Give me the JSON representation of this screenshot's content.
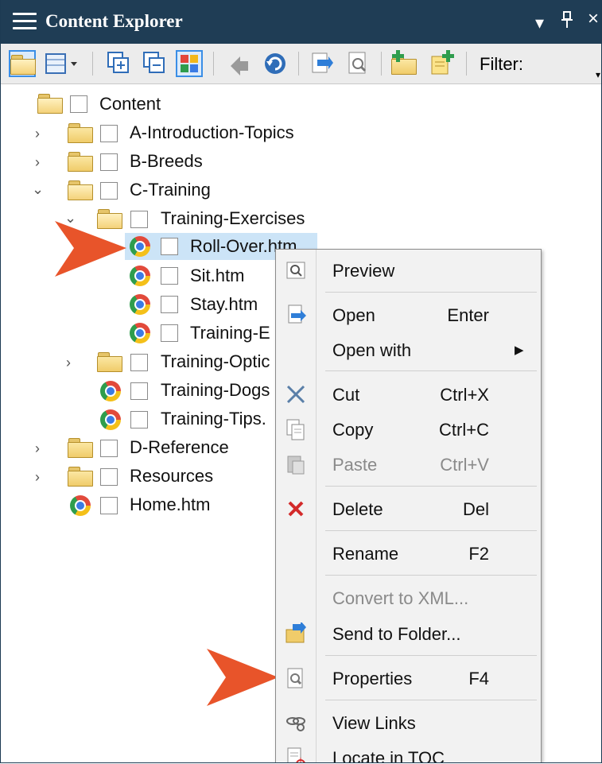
{
  "titlebar": {
    "title": "Content Explorer",
    "dropdown_glyph": "▾",
    "pin_glyph": "ᵽ",
    "close_glyph": "×"
  },
  "toolbar": {
    "filter_label": "Filter:",
    "icons": [
      "open-folder-icon",
      "view-dropdown-icon",
      "expand-all-icon",
      "collapse-all-icon",
      "grid-icon",
      "forward-icon",
      "refresh-icon",
      "bind-icon",
      "properties-icon",
      "new-folder-icon",
      "add-file-icon"
    ]
  },
  "tree": {
    "root": "Content",
    "items": [
      {
        "label": "A-Introduction-Topics",
        "type": "folder",
        "expander": ">"
      },
      {
        "label": "B-Breeds",
        "type": "folder",
        "expander": ">"
      },
      {
        "label": "C-Training",
        "type": "folder",
        "expander": "v"
      },
      {
        "label": "Training-Exercises",
        "type": "folder"
      },
      {
        "label": "Roll-Over.htm",
        "type": "file",
        "selected": true
      },
      {
        "label": "Sit.htm",
        "type": "file"
      },
      {
        "label": "Stay.htm",
        "type": "file"
      },
      {
        "label": "Training-E",
        "type": "file"
      },
      {
        "label": "Training-Optic",
        "type": "folder",
        "expander": ">"
      },
      {
        "label": "Training-Dogs",
        "type": "file"
      },
      {
        "label": "Training-Tips.",
        "type": "file"
      },
      {
        "label": "D-Reference",
        "type": "folder",
        "expander": ">"
      },
      {
        "label": "Resources",
        "type": "folder",
        "expander": ">"
      },
      {
        "label": "Home.htm",
        "type": "file"
      }
    ]
  },
  "context_menu": {
    "items": [
      {
        "label": "Preview",
        "shortcut": "",
        "icon": "preview-icon"
      },
      {
        "label": "Open",
        "shortcut": "Enter",
        "icon": "open-icon"
      },
      {
        "label": "Open with",
        "shortcut": "",
        "submenu": "▶"
      },
      {
        "label": "Cut",
        "shortcut": "Ctrl+X",
        "icon": "cut-icon"
      },
      {
        "label": "Copy",
        "shortcut": "Ctrl+C",
        "icon": "copy-icon"
      },
      {
        "label": "Paste",
        "shortcut": "Ctrl+V",
        "icon": "paste-icon",
        "disabled": true
      },
      {
        "label": "Delete",
        "shortcut": "Del",
        "icon": "delete-icon"
      },
      {
        "label": "Rename",
        "shortcut": "F2"
      },
      {
        "label": "Convert to XML...",
        "shortcut": "",
        "disabled": true
      },
      {
        "label": "Send to Folder...",
        "shortcut": "",
        "icon": "send-to-folder-icon"
      },
      {
        "label": "Properties",
        "shortcut": "F4",
        "icon": "properties-icon"
      },
      {
        "label": "View Links",
        "shortcut": "",
        "icon": "view-links-icon"
      },
      {
        "label": "Locate in TOC",
        "shortcut": "",
        "icon": "locate-toc-icon"
      }
    ]
  },
  "colors": {
    "titlebar": "#1f3d55",
    "selection": "#cce4f7",
    "callout_arrow": "#e8542a"
  }
}
